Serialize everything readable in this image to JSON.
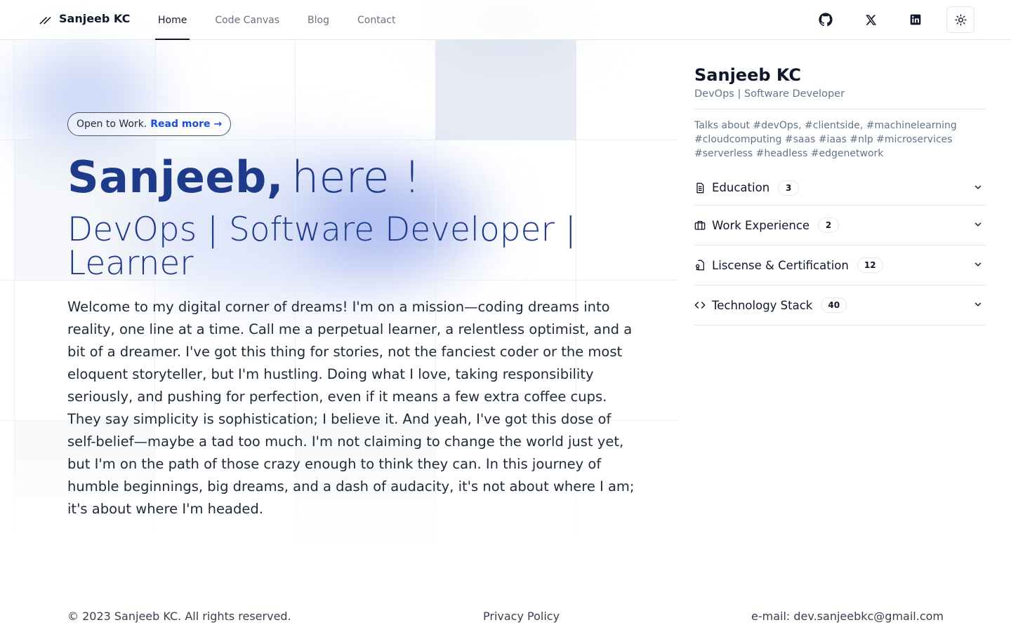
{
  "nav": {
    "brand": "Sanjeeb KC",
    "links": [
      "Home",
      "Code Canvas",
      "Blog",
      "Contact"
    ],
    "active": "Home",
    "icons": [
      "github-icon",
      "x-twitter-icon",
      "linkedin-icon",
      "sun-icon"
    ]
  },
  "hero": {
    "pill_text": "Open to Work.",
    "pill_link": "Read more →",
    "name": "Sanjeeb,",
    "greeting": "here !",
    "subtitle": "DevOps | Software Developer | Learner",
    "bio": "Welcome to my digital corner of dreams! I'm on a mission—coding dreams into reality, one line at a time. Call me a perpetual learner, a relentless optimist, and a bit of a dreamer. I've got this thing for stories, not the fanciest coder or the most eloquent storyteller, but I'm hustling. Doing what I love, taking responsibility seriously, and pushing for perfection, even if it means a few extra coffee cups. They say simplicity is sophistication; I believe it. And yeah, I've got this dose of self-belief—maybe a tad too much. I'm not claiming to change the world just yet, but I'm on the path of those crazy enough to think they can. In this journey of humble beginnings, big dreams, and a dash of audacity, it's not about where I am; it's about where I'm headed."
  },
  "sidebar": {
    "name": "Sanjeeb KC",
    "role": "DevOps | Software Developer",
    "tags": "Talks about #devOps, #clientside, #machinelearning #cloudcomputing #saas #iaas #nlp #microservices #serverless #headless #edgenetwork",
    "sections": [
      {
        "label": "Education",
        "count": "3",
        "icon": "document-icon"
      },
      {
        "label": "Work Experience",
        "count": "2",
        "icon": "briefcase-icon"
      },
      {
        "label": "Liscense & Certification",
        "count": "12",
        "icon": "file-badge-icon"
      },
      {
        "label": "Technology Stack",
        "count": "40",
        "icon": "code-icon"
      }
    ]
  },
  "footer": {
    "copyright": "© 2023 Sanjeeb KC. All rights reserved.",
    "privacy": "Privacy Policy",
    "email": "e-mail: dev.sanjeebkc@gmail.com"
  },
  "colors": {
    "accent": "#1e3a8a",
    "link": "#1d4ed8",
    "muted": "#64748b"
  }
}
